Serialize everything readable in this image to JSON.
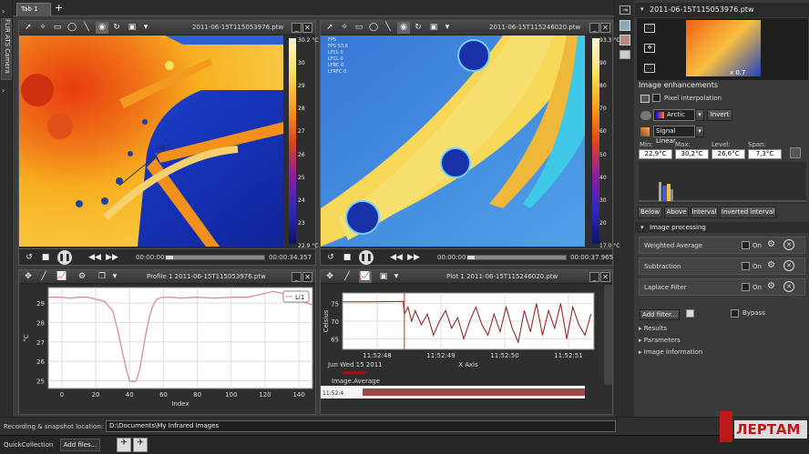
{
  "tab": {
    "label": "Tab 1",
    "add": "+"
  },
  "sidecam": {
    "label": "FLIR ATS Camera"
  },
  "view1": {
    "title": "2011-06-15T115053976.ptw",
    "scale": [
      "30.2 °C",
      "30",
      "29",
      "28",
      "27",
      "26",
      "25",
      "24",
      "23",
      "22.9 °C"
    ],
    "time_start": "00:00:00",
    "time_end": "00:00:34.357"
  },
  "view2": {
    "title": "2011-06-15T115246020.ptw",
    "scale": [
      "93.3 °C",
      "90",
      "80",
      "70",
      "60",
      "50",
      "40",
      "30",
      "20",
      "17.0 °C"
    ],
    "time_start": "00:00:00",
    "time_end": "00:00:37.965",
    "overlay": [
      "FPS",
      "FPS  53.6",
      "LFCL  0",
      "LFCL  0",
      "LFBC  0",
      "LFRFC  0"
    ]
  },
  "profile": {
    "title": "Profile 1 2011-06-15T115053976.ptw",
    "ylabel": "°C",
    "xlabel": "Index",
    "legend": "Li1"
  },
  "plotpanel": {
    "title": "Plot 1 2011-06-15T115246020.ptw",
    "ylabel": "Celsius",
    "xlabel": "X Axis",
    "xdate": "Jun Wed 15 2011",
    "legend": "Image.Average",
    "mini_time": "11:52:4"
  },
  "chart_data": [
    {
      "type": "line",
      "title": "",
      "xlabel": "Index",
      "ylabel": "°C",
      "xlim": [
        -8,
        148
      ],
      "ylim": [
        24.6,
        29.8
      ],
      "xticks": [
        0,
        20,
        40,
        60,
        80,
        100,
        120,
        140
      ],
      "yticks": [
        25,
        26,
        27,
        28,
        29
      ],
      "legend": "top-right",
      "grid": true,
      "series": [
        {
          "name": "Li1",
          "x": [
            -8,
            0,
            5,
            10,
            15,
            20,
            25,
            30,
            33,
            36,
            38,
            40,
            42,
            44,
            46,
            48,
            50,
            52,
            54,
            56,
            60,
            65,
            70,
            80,
            90,
            100,
            110,
            115,
            120,
            125,
            130,
            135,
            140,
            145,
            148
          ],
          "y": [
            29.3,
            29.3,
            29.25,
            29.3,
            29.3,
            29.2,
            29.1,
            28.6,
            27.6,
            26.4,
            25.6,
            25.0,
            24.95,
            25.0,
            25.6,
            26.6,
            27.6,
            28.4,
            28.9,
            29.2,
            29.3,
            29.3,
            29.25,
            29.3,
            29.25,
            29.3,
            29.3,
            29.4,
            29.5,
            29.6,
            29.5,
            29.3,
            29.1,
            29.0,
            28.9
          ]
        }
      ]
    },
    {
      "type": "line",
      "title": "",
      "xlabel": "X Axis",
      "ylabel": "Celsius",
      "ylim": [
        62,
        78
      ],
      "xticks": [
        "11:52:48",
        "11:52:49",
        "11:52:50",
        "11:52:51"
      ],
      "yticks": [
        65,
        70,
        75
      ],
      "legend": "bottom-left",
      "grid": true,
      "series": [
        {
          "name": "Image.Average",
          "x": [
            0,
            0.5,
            1,
            1.02,
            1.08,
            1.14,
            1.2,
            1.3,
            1.4,
            1.5,
            1.6,
            1.7,
            1.8,
            1.9,
            2.0,
            2.1,
            2.2,
            2.3,
            2.4,
            2.5,
            2.6,
            2.7,
            2.8,
            2.9,
            3.0,
            3.1,
            3.2,
            3.3,
            3.4,
            3.5,
            3.6,
            3.7,
            3.8,
            3.9,
            4.0,
            4.1
          ],
          "y": [
            75.5,
            75.5,
            75.6,
            72,
            74,
            70,
            73,
            69,
            72,
            66,
            70,
            73,
            68,
            71,
            65,
            70,
            74,
            69,
            66,
            72,
            67,
            74,
            68,
            64,
            73,
            67,
            75,
            66,
            73,
            68,
            75,
            65,
            74,
            69,
            66,
            72
          ]
        }
      ]
    }
  ],
  "right": {
    "title": "2011-06-15T115053976.ptw",
    "zoom": "x 0.7",
    "enh_title": "Image enhancements",
    "pixel_interp": "Pixel interpolation",
    "palette": "Arctic",
    "invert": "Invert",
    "signal": "Signal Linear",
    "stats": {
      "min_l": "Min:",
      "max_l": "Max:",
      "level_l": "Level:",
      "span_l": "Span:",
      "min": "22,9°C",
      "max": "30,2°C",
      "level": "26,6°C",
      "span": "7,3°C"
    },
    "btns": [
      "Below",
      "Above",
      "Interval",
      "Inverted interval"
    ],
    "proc_title": "Image processing",
    "filters": [
      {
        "name": "Weighted Average",
        "on": "On"
      },
      {
        "name": "Subtraction",
        "on": "On"
      },
      {
        "name": "Laplace Filter",
        "on": "On"
      }
    ],
    "add_filter": "Add filter...",
    "bypass": "Bypass",
    "sections": [
      "Results",
      "Parameters",
      "Image information"
    ]
  },
  "bottom": {
    "rec_label": "Recording & snapshot location:",
    "rec_path": "D:\\Documents\\My Infrared Images",
    "quick": "QuickCollection",
    "add_files": "Add files..."
  },
  "brand": {
    "text": "ЛЕРТАМ",
    "color": "#c01818"
  }
}
